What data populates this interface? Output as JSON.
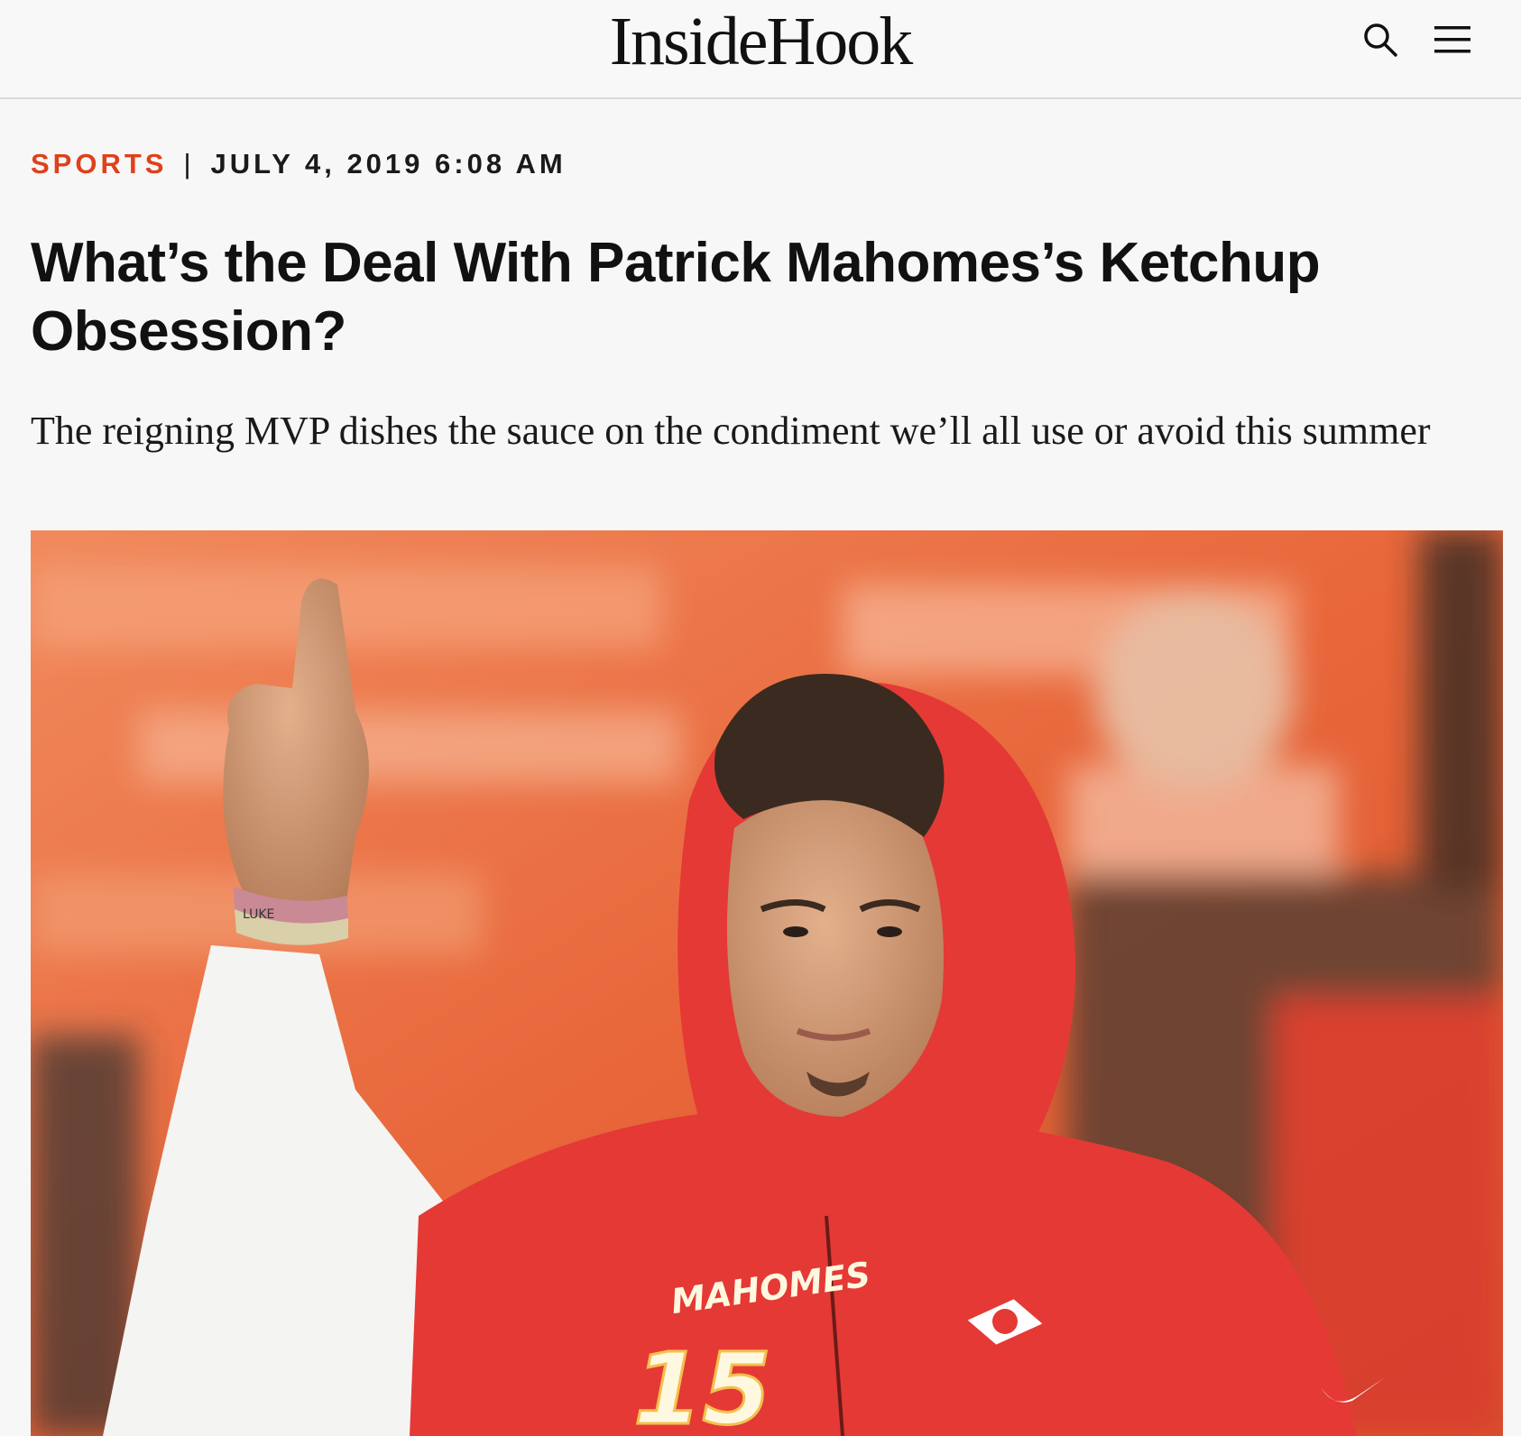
{
  "site": {
    "logo_text": "InsideHook",
    "search_icon": "search-icon",
    "menu_icon": "hamburger-menu-icon"
  },
  "article": {
    "category": "SPORTS",
    "separator": "|",
    "date": "JULY 4, 2019 6:08 AM",
    "title": "What’s the Deal With Patrick Mahomes’s Ketchup Obsession?",
    "dek": "The reigning MVP dishes the sauce on the condiment we’ll all use or avoid this summer"
  },
  "hero_image": {
    "jersey_name": "MAHOMES",
    "jersey_number": "15",
    "wristband_text": "LUKE",
    "colors": {
      "background": "#e8663a",
      "hoodie": "#e53935",
      "accent": "#e0401a"
    }
  }
}
